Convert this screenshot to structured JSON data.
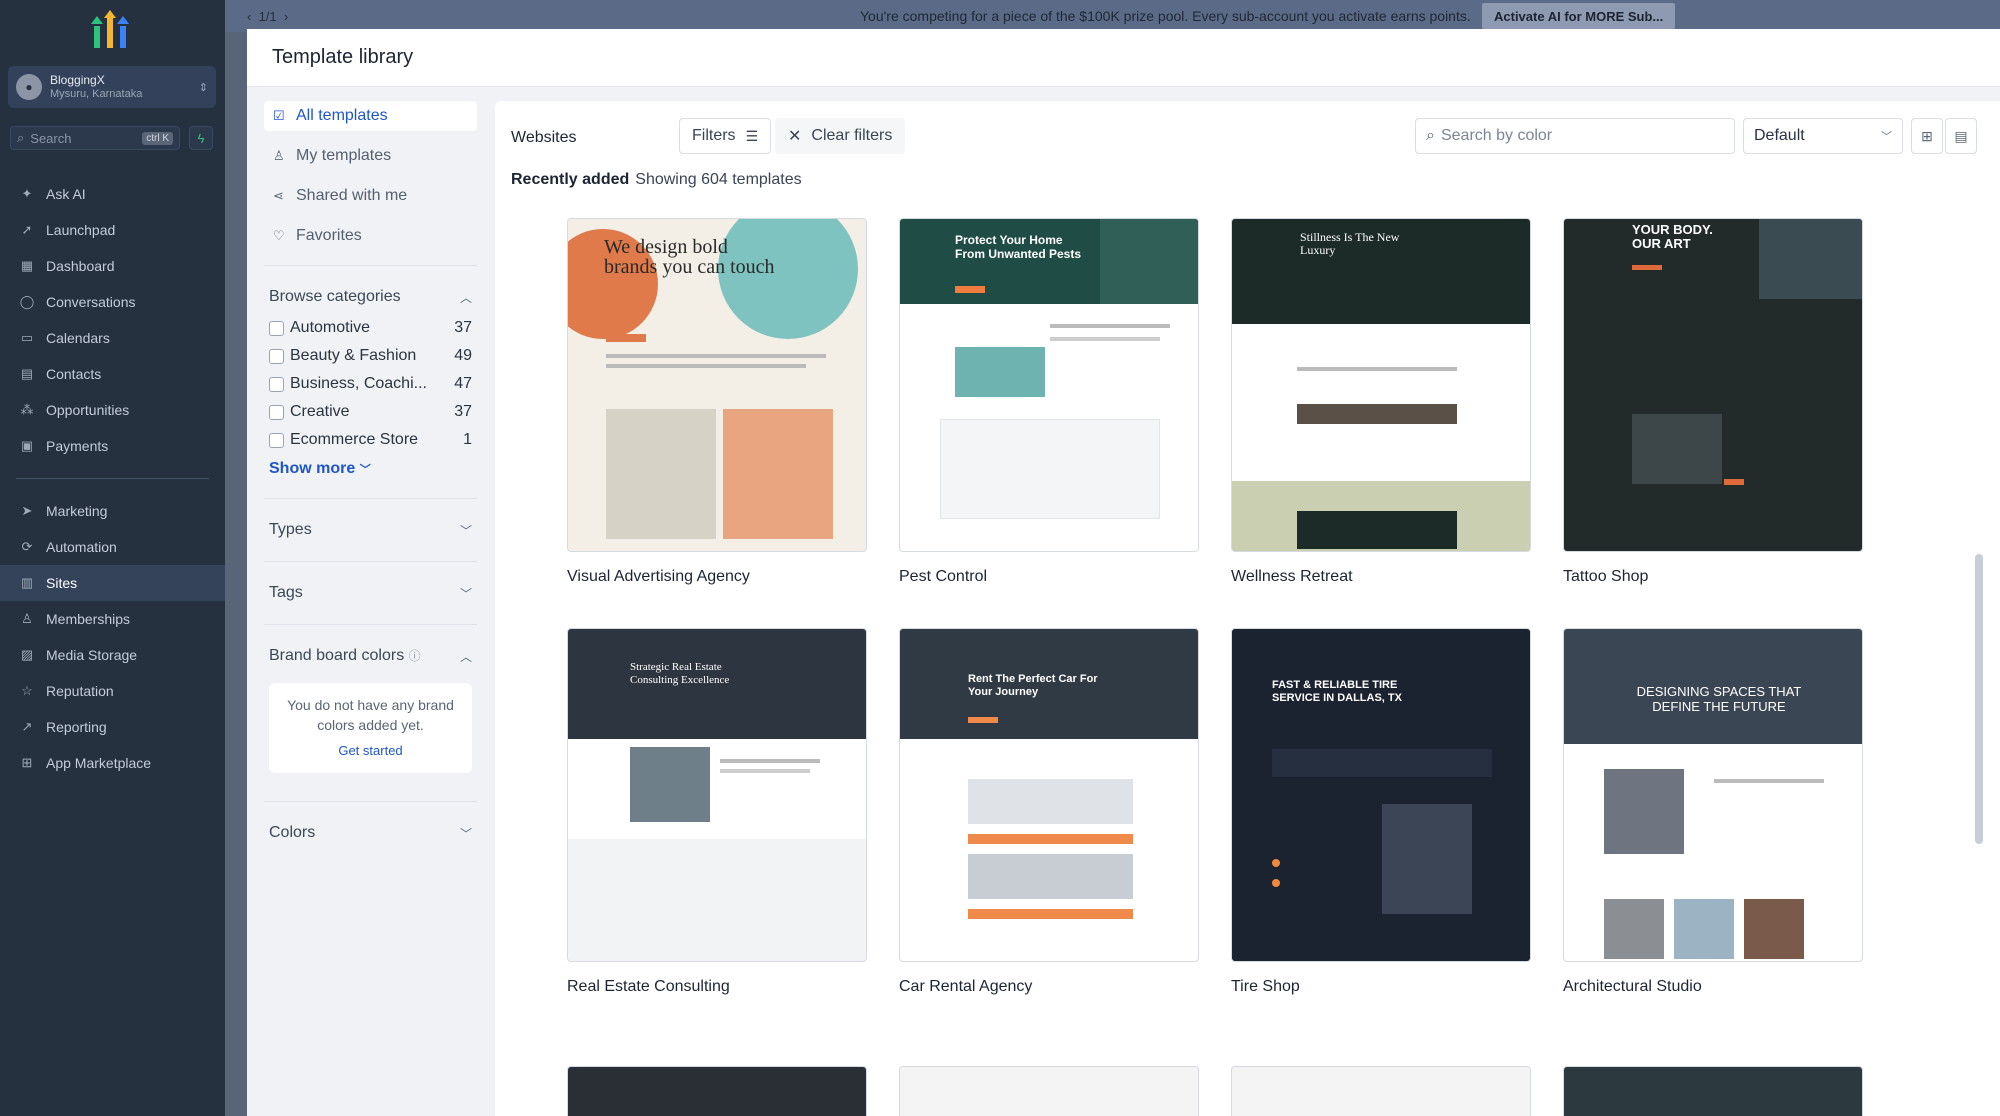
{
  "app_nav": {
    "account_name": "BloggingX",
    "account_location": "Mysuru, Karnataka",
    "search_placeholder": "Search",
    "search_shortcut": "ctrl K",
    "items": [
      {
        "label": "Ask AI",
        "icon": "sparkle-icon"
      },
      {
        "label": "Launchpad",
        "icon": "rocket-icon"
      },
      {
        "label": "Dashboard",
        "icon": "dashboard-icon"
      },
      {
        "label": "Conversations",
        "icon": "chat-icon"
      },
      {
        "label": "Calendars",
        "icon": "calendar-icon"
      },
      {
        "label": "Contacts",
        "icon": "contacts-icon"
      },
      {
        "label": "Opportunities",
        "icon": "opportunities-icon"
      },
      {
        "label": "Payments",
        "icon": "payments-icon"
      }
    ],
    "items2": [
      {
        "label": "Marketing",
        "icon": "send-icon"
      },
      {
        "label": "Automation",
        "icon": "automation-icon"
      },
      {
        "label": "Sites",
        "icon": "sites-icon",
        "active": true
      },
      {
        "label": "Memberships",
        "icon": "memberships-icon"
      },
      {
        "label": "Media Storage",
        "icon": "media-icon"
      },
      {
        "label": "Reputation",
        "icon": "star-icon"
      },
      {
        "label": "Reporting",
        "icon": "reporting-icon"
      },
      {
        "label": "App Marketplace",
        "icon": "apps-icon"
      }
    ]
  },
  "topbar": {
    "pager": "1/1",
    "message": "You're competing for a piece of the $100K prize pool. Every sub-account you activate earns points.",
    "cta": "Activate AI for MORE Sub..."
  },
  "modal": {
    "title": "Template library",
    "nav": {
      "all": "All templates",
      "mine": "My templates",
      "shared": "Shared with me",
      "favorites": "Favorites"
    },
    "browse_title": "Browse categories",
    "categories": [
      {
        "name": "Automotive",
        "count": "37"
      },
      {
        "name": "Beauty & Fashion",
        "count": "49"
      },
      {
        "name": "Business, Coachi...",
        "count": "47"
      },
      {
        "name": "Creative",
        "count": "37"
      },
      {
        "name": "Ecommerce Store",
        "count": "1"
      }
    ],
    "show_more": "Show more",
    "types": "Types",
    "tags": "Tags",
    "brand_colors": "Brand board colors",
    "brand_empty": "You do not have any brand colors added yet.",
    "get_started": "Get started",
    "colors": "Colors"
  },
  "main": {
    "websites": "Websites",
    "filters": "Filters",
    "clear_filters": "Clear filters",
    "search_color_placeholder": "Search by color",
    "sort": "Default",
    "recent_label": "Recently added",
    "showing": "Showing 604 templates",
    "templates": [
      {
        "name": "Visual Advertising Agency",
        "headline": "We design bold brands you can touch",
        "bg": "#f3efe6",
        "accent": "#e07a4a"
      },
      {
        "name": "Pest Control",
        "headline": "Protect Your Home From Unwanted Pests",
        "bg": "#1f4d45",
        "accent": "#f07d3d"
      },
      {
        "name": "Wellness Retreat",
        "headline": "Stillness Is The New Luxury",
        "bg": "#1c2a28",
        "accent": "#c9cfb0"
      },
      {
        "name": "Tattoo Shop",
        "headline": "YOUR BODY. OUR ART",
        "bg": "#222a2a",
        "accent": "#e06a3a"
      },
      {
        "name": "Real Estate Consulting",
        "headline": "Strategic Real Estate Consulting Excellence",
        "bg": "#2d3640",
        "accent": "#e28a4c"
      },
      {
        "name": "Car Rental Agency",
        "headline": "Rent The Perfect Car For Your Journey",
        "bg": "#2f3a45",
        "accent": "#f08a4b"
      },
      {
        "name": "Tire Shop",
        "headline": "FAST & RELIABLE TIRE SERVICE IN DALLAS, TX",
        "bg": "#1b2230",
        "accent": "#f08a3c"
      },
      {
        "name": "Architectural Studio",
        "headline": "DESIGNING SPACES THAT DEFINE THE FUTURE",
        "bg": "#3b4654",
        "accent": "#ffffff"
      }
    ]
  }
}
